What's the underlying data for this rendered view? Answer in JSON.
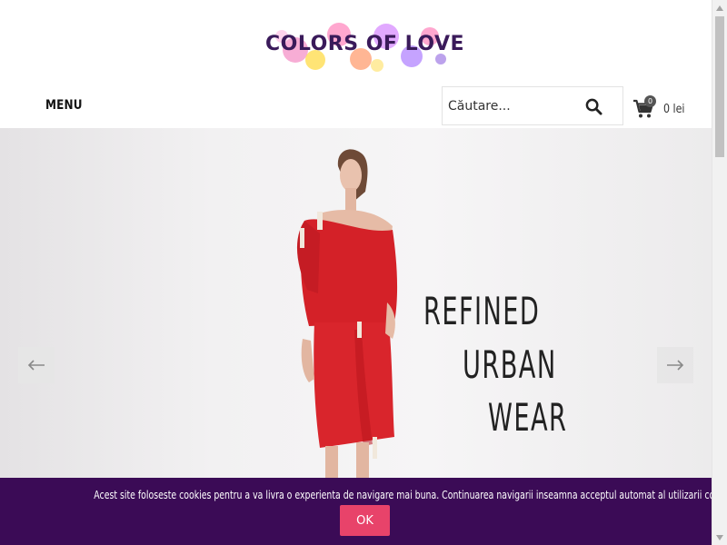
{
  "header": {
    "logo_text": "COLORS OF LOVE",
    "menu_label": "MENU",
    "search": {
      "placeholder": "Căutare..."
    },
    "cart": {
      "count": "0",
      "total": "0 lei"
    }
  },
  "hero": {
    "slogan": [
      "REFINED",
      "URBAN",
      "WEAR"
    ]
  },
  "cookie_banner": {
    "text": "Acest site foloseste cookies pentru a va livra o experienta de navigare mai buna. Continuarea navigarii inseamna acceptul automat al utilizarii cookie-urilor.",
    "ok_label": "OK"
  },
  "colors": {
    "banner_bg": "#3b0b56",
    "ok_button": "#e8436a",
    "dress_red": "#d42128"
  },
  "icons": [
    "search-icon",
    "cart-icon",
    "arrow-left-icon",
    "arrow-right-icon"
  ]
}
